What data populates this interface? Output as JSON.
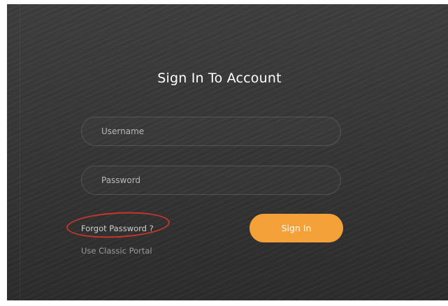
{
  "login": {
    "title": "Sign In To Account",
    "username_placeholder": "Username",
    "password_placeholder": "Password",
    "forgot_password_label": "Forgot Password ?",
    "classic_portal_label": "Use Classic Portal",
    "sign_in_label": "Sign In"
  },
  "colors": {
    "panel_background": "#363636",
    "accent": "#f5a13a",
    "annotation_circle": "#c8362b",
    "title_text": "#ffffff"
  }
}
